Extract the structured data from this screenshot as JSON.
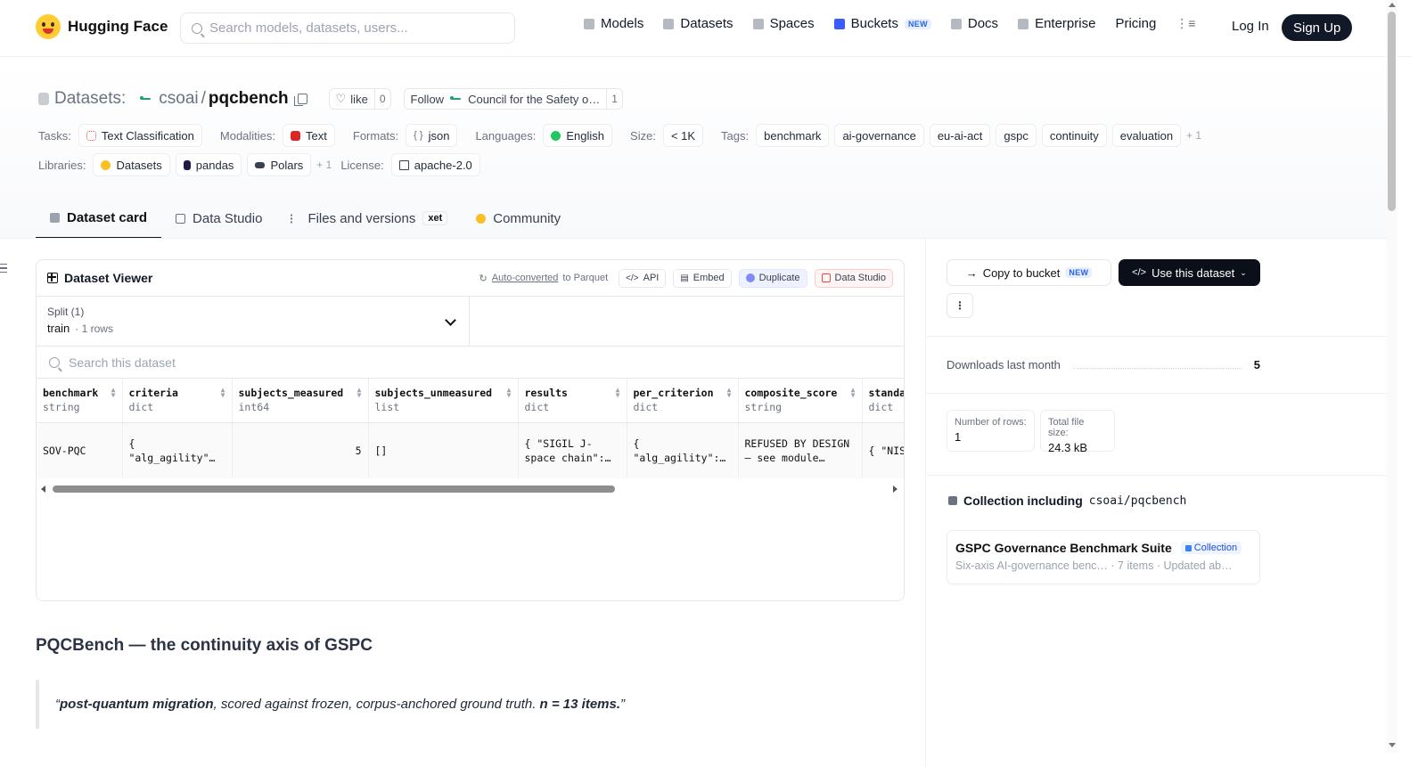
{
  "nav": {
    "brand": "Hugging Face",
    "search_placeholder": "Search models, datasets, users...",
    "links": [
      {
        "label": "Models",
        "icon": "cube-icon"
      },
      {
        "label": "Datasets",
        "icon": "database-icon"
      },
      {
        "label": "Spaces",
        "icon": "grid-icon"
      },
      {
        "label": "Buckets",
        "icon": "bucket-icon",
        "badge": "NEW"
      },
      {
        "label": "Docs",
        "icon": "book-icon"
      },
      {
        "label": "Enterprise",
        "icon": "enterprise-icon"
      },
      {
        "label": "Pricing"
      }
    ],
    "login": "Log In",
    "signup": "Sign Up"
  },
  "repo": {
    "prefix": "Datasets:",
    "owner": "csoai",
    "sep": "/",
    "name": "pqcbench",
    "like_label": "like",
    "like_count": "0",
    "follow_label": "Follow",
    "follow_org": "Council for the Safety o…",
    "follow_count": "1"
  },
  "meta": {
    "tasks_label": "Tasks:",
    "tasks": [
      "Text Classification"
    ],
    "modalities_label": "Modalities:",
    "modalities": [
      "Text"
    ],
    "formats_label": "Formats:",
    "formats": [
      "json"
    ],
    "languages_label": "Languages:",
    "languages": [
      "English"
    ],
    "size_label": "Size:",
    "size": "< 1K",
    "tags_label": "Tags:",
    "tags": [
      "benchmark",
      "ai-governance",
      "eu-ai-act",
      "gspc",
      "continuity",
      "evaluation"
    ],
    "tags_more": "+ 1",
    "libraries_label": "Libraries:",
    "libraries": [
      "Datasets",
      "pandas",
      "Polars"
    ],
    "libraries_more": "+ 1",
    "license_label": "License:",
    "license": "apache-2.0"
  },
  "tabs": [
    {
      "label": "Dataset card",
      "active": true
    },
    {
      "label": "Data Studio"
    },
    {
      "label": "Files and versions",
      "badge": "xet"
    },
    {
      "label": "Community"
    }
  ],
  "viewer": {
    "title": "Dataset Viewer",
    "auto_converted": "Auto-converted",
    "to_parquet": "to Parquet",
    "btn_api": "API",
    "btn_embed": "Embed",
    "btn_duplicate": "Duplicate",
    "btn_studio": "Data Studio",
    "split_label": "Split (1)",
    "split_value": "train",
    "split_rows": "· 1 rows",
    "search_placeholder": "Search this dataset",
    "columns": [
      {
        "name": "benchmark",
        "type": "string"
      },
      {
        "name": "criteria",
        "type": "dict"
      },
      {
        "name": "subjects_measured",
        "type": "int64"
      },
      {
        "name": "subjects_unmeasured",
        "type": "list"
      },
      {
        "name": "results",
        "type": "dict"
      },
      {
        "name": "per_criterion",
        "type": "dict"
      },
      {
        "name": "composite_score",
        "type": "string"
      },
      {
        "name": "standa",
        "type": "dict"
      }
    ],
    "row": [
      "SOV-PQC",
      "{ \"alg_agility\"…",
      "5",
      "[]",
      "{ \"SIGIL J-space chain\":…",
      "{ \"alg_agility\":…",
      "REFUSED BY DESIGN — see module…",
      "{ \"NIS \"EdDSA"
    ]
  },
  "card": {
    "heading": "PQCBench — the continuity axis of GSPC",
    "quote_open": "“",
    "quote_bold1": "post-quantum migration",
    "quote_mid": ", scored against frozen, corpus-anchored ground truth. ",
    "quote_bold2": "n = 13 items.",
    "quote_close": "”"
  },
  "sidebar": {
    "copy_bucket": "Copy to bucket",
    "copy_badge": "NEW",
    "use_dataset": "Use this dataset",
    "downloads_label": "Downloads last month",
    "downloads": "5",
    "rows_label": "Number of rows:",
    "rows": "1",
    "size_label": "Total file size:",
    "size": "24.3 kB",
    "collection_prefix": "Collection including",
    "collection_repo": "csoai/pqcbench",
    "collection_name": "GSPC Governance Benchmark Suite",
    "collection_badge": "Collection",
    "collection_desc": "Six-axis AI-governance benc…",
    "collection_items": "7 items",
    "collection_updated": "Updated ab…"
  }
}
